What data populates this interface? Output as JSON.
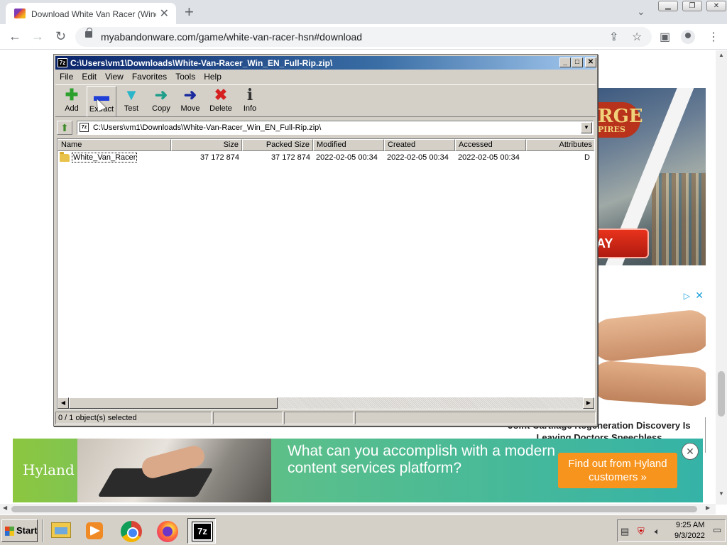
{
  "browser": {
    "tab_title": "Download White Van Racer (Windows)",
    "tab_close": "✕",
    "new_tab": "+",
    "url": "myabandonware.com/game/white-van-racer-hsn#download",
    "nav": {
      "back": "←",
      "forward": "→",
      "reload": "↻"
    },
    "icons": {
      "share": "share-icon",
      "bookmark": "☆",
      "sidepanel": "sidepanel-icon",
      "menu": "⋮",
      "tabsearch": "⌄"
    }
  },
  "ads": {
    "game_logo_line1": "RGE",
    "game_logo_line2": "PIRES",
    "game_play": "AY",
    "legs_headline": "Joint Cartilage Regeneration Discovery Is Leaving Doctors Speechless",
    "banner_brand": "Hyland",
    "banner_message": "What can you accomplish with a modern content services platform?",
    "banner_cta": "Find out from Hyland customers »",
    "adchoices": "▷",
    "close": "✕"
  },
  "sevenzip": {
    "title": "C:\\Users\\vm1\\Downloads\\White-Van-Racer_Win_EN_Full-Rip.zip\\",
    "app_icon": "7z",
    "menu": [
      "File",
      "Edit",
      "View",
      "Favorites",
      "Tools",
      "Help"
    ],
    "tools": [
      {
        "label": "Add",
        "glyph": "✚",
        "color": "#2ca02c"
      },
      {
        "label": "Extract",
        "glyph": "▬",
        "color": "#1f3fd8"
      },
      {
        "label": "Test",
        "glyph": "▼",
        "color": "#2bb5c9"
      },
      {
        "label": "Copy",
        "glyph": "➜",
        "color": "#1f9e8a"
      },
      {
        "label": "Move",
        "glyph": "➜",
        "color": "#1a2a9e"
      },
      {
        "label": "Delete",
        "glyph": "✖",
        "color": "#d62020"
      },
      {
        "label": "Info",
        "glyph": "i",
        "color": "#333333"
      }
    ],
    "address": "C:\\Users\\vm1\\Downloads\\White-Van-Racer_Win_EN_Full-Rip.zip\\",
    "columns": [
      "Name",
      "Size",
      "Packed Size",
      "Modified",
      "Created",
      "Accessed",
      "Attributes"
    ],
    "rows": [
      {
        "name": "White_Van_Racer",
        "size": "37 172 874",
        "packed": "37 172 874",
        "modified": "2022-02-05 00:34",
        "created": "2022-02-05 00:34",
        "accessed": "2022-02-05 00:34",
        "attributes": "D"
      }
    ],
    "status": "0 / 1 object(s) selected"
  },
  "taskbar": {
    "start_label": "Start",
    "apps": [
      "file-explorer",
      "media-player",
      "chrome",
      "firefox",
      "7-zip"
    ],
    "clock_time": "9:25 AM",
    "clock_date": "9/3/2022"
  }
}
